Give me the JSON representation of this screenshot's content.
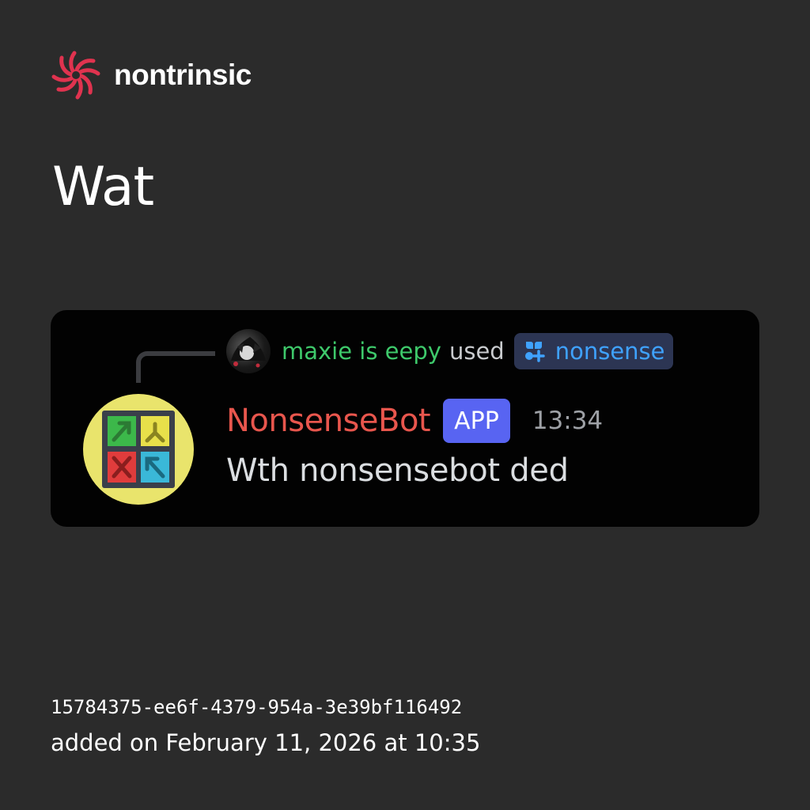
{
  "brand": {
    "name": "nontrinsic",
    "logo_icon": "spiral-swirl-icon",
    "logo_color": "#e0334f"
  },
  "post": {
    "title": "Wat"
  },
  "screenshot": {
    "command": {
      "user_name": "maxie is eepy",
      "user_color": "#3ec96b",
      "action_text": "used",
      "command_name": "nonsense",
      "command_icon": "app-command-icon",
      "command_color": "#3fa2ff"
    },
    "message": {
      "author": "NonsenseBot",
      "author_color": "#e8564d",
      "tag": "APP",
      "tag_color": "#5864f2",
      "time": "13:34",
      "text": "Wth nonsensebot ded",
      "avatar_icon": "four-arrow-grid-icon"
    }
  },
  "meta": {
    "id": "15784375-ee6f-4379-954a-3e39bf116492",
    "added_on": "added on February 11, 2026 at 10:35"
  }
}
